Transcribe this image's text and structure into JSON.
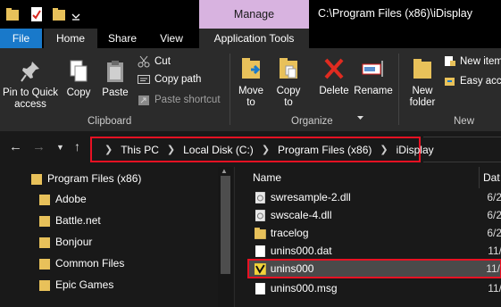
{
  "titlebar": {
    "manage_label": "Manage",
    "path_title": "C:\\Program Files (x86)\\iDisplay",
    "qat_icons": [
      "folder-icon",
      "properties-checkmark-icon",
      "new-folder-icon",
      "customize-qat-icon"
    ]
  },
  "tabs": {
    "file": "File",
    "home": "Home",
    "share": "Share",
    "view": "View",
    "app_tools": "Application Tools"
  },
  "ribbon": {
    "clipboard": {
      "pin_label": "Pin to Quick access",
      "copy_label": "Copy",
      "paste_label": "Paste",
      "cut_label": "Cut",
      "copy_path_label": "Copy path",
      "paste_shortcut_label": "Paste shortcut",
      "group_label": "Clipboard"
    },
    "organize": {
      "move_to_label": "Move to",
      "copy_to_label": "Copy to",
      "delete_label": "Delete",
      "rename_label": "Rename",
      "group_label": "Organize"
    },
    "new": {
      "new_folder_label": "New folder",
      "new_item_label": "New item",
      "easy_access_label": "Easy access",
      "group_label": "New"
    }
  },
  "address": {
    "crumbs": [
      "This PC",
      "Local Disk (C:)",
      "Program Files (x86)",
      "iDisplay"
    ]
  },
  "nav": {
    "items": [
      {
        "label": "Program Files (x86)"
      },
      {
        "label": "Adobe"
      },
      {
        "label": "Battle.net"
      },
      {
        "label": "Bonjour"
      },
      {
        "label": "Common Files"
      },
      {
        "label": "Epic Games"
      }
    ]
  },
  "content": {
    "col_name": "Name",
    "col_date": "Dat",
    "files": [
      {
        "name": "swresample-2.dll",
        "date": "6/2",
        "icon": "dll-file-icon"
      },
      {
        "name": "swscale-4.dll",
        "date": "6/2",
        "icon": "dll-file-icon"
      },
      {
        "name": "tracelog",
        "date": "6/2",
        "icon": "folder-icon"
      },
      {
        "name": "unins000.dat",
        "date": "11/",
        "icon": "dat-file-icon"
      },
      {
        "name": "unins000",
        "date": "11/",
        "icon": "uninstaller-icon",
        "selected": true
      },
      {
        "name": "unins000.msg",
        "date": "11/",
        "icon": "msg-file-icon"
      }
    ]
  },
  "colors": {
    "accent": "#1979ca",
    "manage_tab": "#d8b3e0",
    "highlight_border": "#e81123",
    "ribbon_bg": "#2b2b2b",
    "window_bg": "#191919"
  }
}
